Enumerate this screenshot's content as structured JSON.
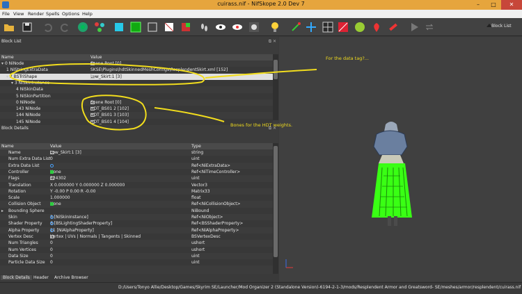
{
  "window": {
    "title": "cuirass.nif - NifSkope 2.0 Dev 7",
    "minimize": "–",
    "maximize": "□",
    "close": "✕"
  },
  "menu": [
    "File",
    "View",
    "Render",
    "Spells",
    "Options",
    "Help"
  ],
  "toolbar": {
    "block_list_label": "Block List"
  },
  "block_list": {
    "title": "Block List",
    "columns": {
      "name": "Name",
      "value": "Value"
    },
    "rows": [
      {
        "indent": 0,
        "tri": "▾",
        "name": "0 NiNode",
        "value": "Scene Root [0]",
        "icon": "box"
      },
      {
        "indent": 1,
        "tri": "",
        "name": "1 NiStringExtraData",
        "value": "SKSE\\Plugins\\hdtSkinnedMeshConfigs\\ResplendentSkirt.xml [152]",
        "icon": ""
      },
      {
        "indent": 1,
        "tri": "▾",
        "name": "2 BSTriShape",
        "value": "Low_Skirt:1 [3]",
        "icon": "tag",
        "selected": true
      },
      {
        "indent": 2,
        "tri": "▾",
        "name": "3 NiSkinInstance",
        "value": "",
        "icon": ""
      },
      {
        "indent": 3,
        "tri": "",
        "name": "4 NiSkinData",
        "value": "",
        "icon": ""
      },
      {
        "indent": 3,
        "tri": "",
        "name": "5 NiSkinPartition",
        "value": "",
        "icon": ""
      },
      {
        "indent": 3,
        "tri": "",
        "name": "0 NiNode",
        "value": "Scene Root [0]",
        "icon": "box"
      },
      {
        "indent": 3,
        "tri": "",
        "name": "143 NiNode",
        "value": "HDT_BS01 2 [102]",
        "icon": "box"
      },
      {
        "indent": 3,
        "tri": "",
        "name": "144 NiNode",
        "value": "HDT_BS01 3 [103]",
        "icon": "box"
      },
      {
        "indent": 3,
        "tri": "",
        "name": "145 NiNode",
        "value": "HDT_BS01 4 [104]",
        "icon": "box"
      }
    ]
  },
  "block_details": {
    "title": "Block Details",
    "columns": {
      "name": "Name",
      "value": "Value",
      "type": "Type"
    },
    "rows": [
      {
        "tri": "",
        "name": "Name",
        "icon": "tag",
        "value": "Low_Skirt:1 [3]",
        "type": "string"
      },
      {
        "tri": "",
        "name": "Num Extra Data List",
        "icon": "",
        "value": "0",
        "type": "uint"
      },
      {
        "tri": "",
        "name": "Extra Data List",
        "icon": "link",
        "value": "",
        "type": "Ref<NiExtraData>"
      },
      {
        "tri": "",
        "name": "Controller",
        "icon": "plus",
        "value": "None",
        "type": "Ref<NiTimeController>"
      },
      {
        "tri": "",
        "name": "Flags",
        "icon": "box",
        "value": "524302",
        "type": "uint"
      },
      {
        "tri": "",
        "name": "Translation",
        "icon": "",
        "value": "X 0.000000 Y 0.000000 Z 0.000000",
        "type": "Vector3"
      },
      {
        "tri": "",
        "name": "Rotation",
        "icon": "",
        "value": "Y -0.00 P 0.00 R -0.00",
        "type": "Matrix33"
      },
      {
        "tri": "",
        "name": "Scale",
        "icon": "",
        "value": "1.000000",
        "type": "float"
      },
      {
        "tri": "",
        "name": "Collision Object",
        "icon": "plus",
        "value": "None",
        "type": "Ref<NiCollisionObject>"
      },
      {
        "tri": "▸",
        "name": "Bounding Sphere",
        "icon": "",
        "value": "",
        "type": "NiBound"
      },
      {
        "tri": "",
        "name": "Skin",
        "icon": "link",
        "value": "3 [NiSkinInstance]",
        "type": "Ref<NiObject>"
      },
      {
        "tri": "",
        "name": "Shader Property",
        "icon": "link",
        "value": "6 [BSLightingShaderProperty]",
        "type": "Ref<BSShaderProperty>"
      },
      {
        "tri": "",
        "name": "Alpha Property",
        "icon": "link",
        "value": "11 [NiAlphaProperty]",
        "type": "Ref<NiAlphaProperty>"
      },
      {
        "tri": "",
        "name": "Vertex Desc",
        "icon": "box",
        "value": "Vertex | UVs | Normals | Tangents | Skinned",
        "type": "BSVertexDesc"
      },
      {
        "tri": "",
        "name": "Num Triangles",
        "icon": "",
        "value": "0",
        "type": "ushort"
      },
      {
        "tri": "",
        "name": "Num Vertices",
        "icon": "",
        "value": "0",
        "type": "ushort"
      },
      {
        "tri": "",
        "name": "Data Size",
        "icon": "",
        "value": "0",
        "type": "uint"
      },
      {
        "tri": "",
        "name": "Particle Data Size",
        "icon": "",
        "value": "0",
        "type": "uint"
      }
    ]
  },
  "tabs": [
    "Block Details",
    "Header",
    "Archive Browser"
  ],
  "status_path": "D:/Users/Tonyo Allie/Desktop/Games/Skyrim SE/Launcher/Mod Organizer 2 (Standalone Version)-6194-2-1-3/mods/Resplendent Armor and Greatsword- SE/meshes/armor/resplendent/cuirass.nif",
  "annotations": {
    "data_tag": "For the data tag?...",
    "bones": "Bones for the HDT weights."
  },
  "colors": {
    "titlebar": "#e6a53d",
    "annotation": "#f2dd1d",
    "skirt": "#39ff14",
    "selection": "#e0e0e0"
  }
}
